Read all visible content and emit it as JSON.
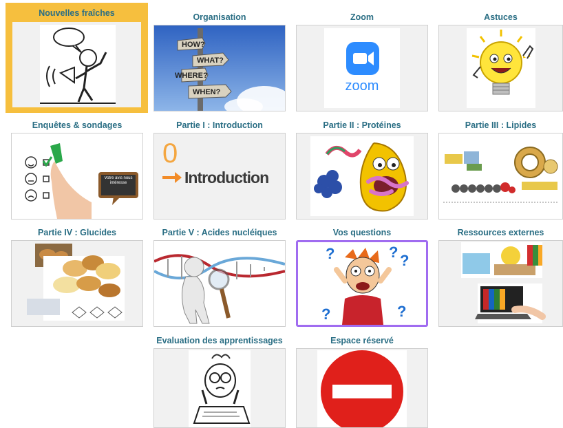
{
  "tiles": [
    {
      "label": "Nouvelles fraîches"
    },
    {
      "label": "Organisation",
      "signs": [
        "HOW?",
        "WHAT?",
        "WHERE?",
        "WHEN?"
      ]
    },
    {
      "label": "Zoom",
      "logo_text": "zoom"
    },
    {
      "label": "Astuces"
    },
    {
      "label": "Enquêtes & sondages",
      "board_text": "Votre avis nous intéresse"
    },
    {
      "label": "Partie I : Introduction",
      "big_number": "0",
      "intro_text": "Introduction"
    },
    {
      "label": "Partie II : Protéines"
    },
    {
      "label": "Partie III : Lipides"
    },
    {
      "label": "Partie IV : Glucides"
    },
    {
      "label": "Partie V : Acides nucléiques"
    },
    {
      "label": "Vos questions"
    },
    {
      "label": "Ressources externes"
    },
    {
      "label": "Evaluation des apprentissages"
    },
    {
      "label": "Espace réservé"
    }
  ],
  "colors": {
    "label": "#2a6e84",
    "featured_bg": "#f6bf3e",
    "selected_border": "#a06cf0",
    "zoom_blue": "#2d8cff",
    "stop_red": "#e0201b"
  },
  "icons": [
    "megaphone-person-icon",
    "signpost-icon",
    "zoom-logo-icon",
    "lightbulb-icon",
    "survey-hand-icon",
    "introduction-icon",
    "protein-icon",
    "lipid-icon",
    "carbohydrate-foods-icon",
    "dna-magnifier-icon",
    "confused-person-icon",
    "external-resources-icon",
    "thinking-student-icon",
    "no-entry-icon"
  ]
}
